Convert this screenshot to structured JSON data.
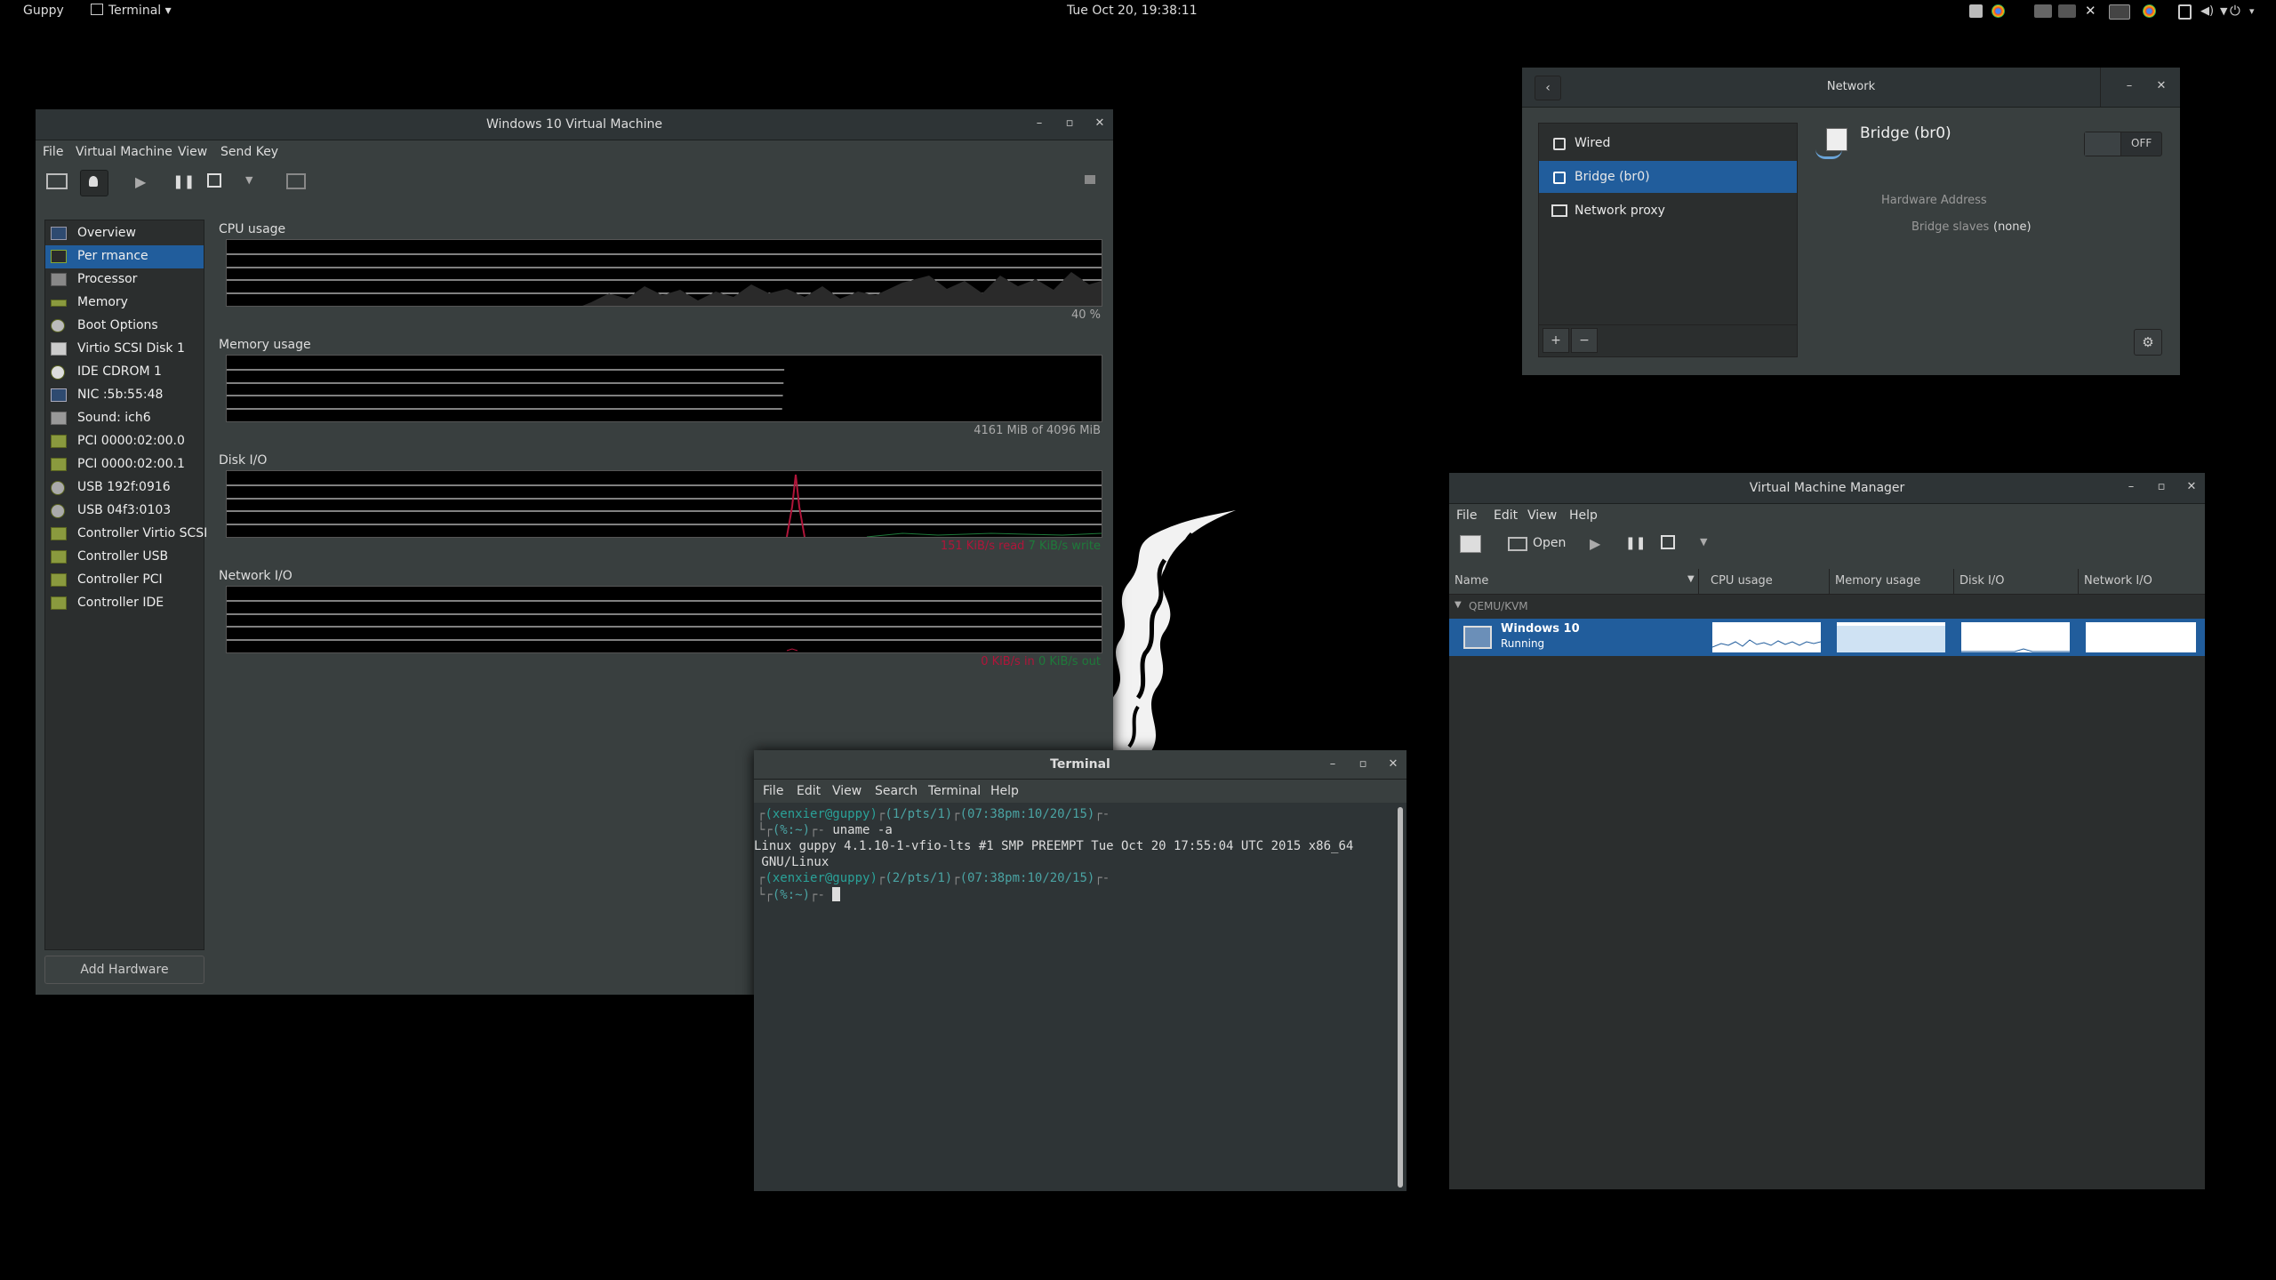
{
  "topbar": {
    "activities": "Guppy",
    "app_menu": "Terminal",
    "clock": "Tue Oct 20, 19:38:11"
  },
  "vm_window": {
    "title": "Windows 10 Virtual Machine",
    "menu": [
      "File",
      "Virtual Machine",
      "View",
      "Send Key"
    ],
    "sidebar": [
      {
        "label": "Overview",
        "icon": "monitor-icon"
      },
      {
        "label": "Per   rmance",
        "icon": "graph-icon"
      },
      {
        "label": "Processor",
        "icon": "cpu-icon"
      },
      {
        "label": "Memory",
        "icon": "memory-icon"
      },
      {
        "label": "Boot Options",
        "icon": "boot-gear-icon"
      },
      {
        "label": "Virtio SCSI Disk 1",
        "icon": "disk-icon"
      },
      {
        "label": "IDE CDROM 1",
        "icon": "cdrom-icon"
      },
      {
        "label": "NIC :5b:55:48",
        "icon": "nic-icon"
      },
      {
        "label": "Sound: ich6",
        "icon": "speaker-icon"
      },
      {
        "label": "PCI 0000:02:00.0",
        "icon": "pci-card-icon"
      },
      {
        "label": "PCI 0000:02:00.1",
        "icon": "pci-card-icon"
      },
      {
        "label": "USB 192f:0916",
        "icon": "usb-icon"
      },
      {
        "label": "USB 04f3:0103",
        "icon": "usb-icon"
      },
      {
        "label": "Controller Virtio SCSI",
        "icon": "controller-icon"
      },
      {
        "label": "Controller USB",
        "icon": "controller-icon"
      },
      {
        "label": "Controller PCI",
        "icon": "controller-icon"
      },
      {
        "label": "Controller IDE",
        "icon": "controller-icon"
      }
    ],
    "selected_index": 1,
    "add_hardware": "Add Hardware",
    "sections": {
      "cpu_label": "CPU usage",
      "cpu_value": "40 %",
      "mem_label": "Memory usage",
      "mem_value": "4161 MiB of 4096 MiB",
      "disk_label": "Disk I/O",
      "disk_read": "151 KiB/s read",
      "disk_write": "7 KiB/s write",
      "net_label": "Network I/O",
      "net_in": "0 KiB/s in",
      "net_out": "0 KiB/s out"
    }
  },
  "network_window": {
    "title": "Network",
    "items": [
      "Wired",
      "Bridge (br0)",
      "Network proxy"
    ],
    "selected_index": 1,
    "detail_title": "Bridge (br0)",
    "toggle": "OFF",
    "hw_address_label": "Hardware Address",
    "bridge_slaves_label": "Bridge slaves",
    "bridge_slaves_value": "(none)",
    "add": "+",
    "remove": "−"
  },
  "vmm_window": {
    "title": "Virtual Machine Manager",
    "menu": [
      "File",
      "Edit",
      "View",
      "Help"
    ],
    "open_label": "Open",
    "columns": [
      "Name",
      "CPU usage",
      "Memory usage",
      "Disk I/O",
      "Network I/O"
    ],
    "group": "QEMU/KVM",
    "vm_name": "Windows 10",
    "vm_state": "Running"
  },
  "terminal": {
    "title": "Terminal",
    "menu": [
      "File",
      "Edit",
      "View",
      "Search",
      "Terminal",
      "Help"
    ],
    "line1_user": "(xenxier@guppy)",
    "line1_tty": "(1/pts/1)",
    "line1_time": "(07:38pm:10/20/15)",
    "prompt_dir": "(%:~)",
    "command": "uname -a",
    "output1": "Linux guppy 4.1.10-1-vfio-lts #1 SMP PREEMPT Tue Oct 20 17:55:04 UTC 2015 x86_64",
    "output2": " GNU/Linux",
    "line3_user": "(xenxier@guppy)",
    "line3_tty": "(2/pts/1)",
    "line3_time": "(07:38pm:10/20/15)",
    "prompt_dir2": "(%:~)"
  },
  "colors": {
    "selection": "#215d9c",
    "window_bg": "#393f3f",
    "titlebar": "#2e3436",
    "disk_read": "#b0153a",
    "disk_write": "#1e7a3a",
    "terminal_prompt": "#2aa198"
  }
}
